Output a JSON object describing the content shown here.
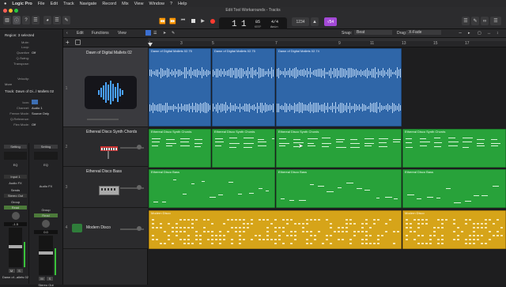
{
  "menubar": {
    "items": [
      "Logic Pro",
      "File",
      "Edit",
      "Track",
      "Navigate",
      "Record",
      "Mix",
      "View",
      "Window",
      "?",
      "Help"
    ]
  },
  "window": {
    "title": "Edit Tool Workarounds - Tracks"
  },
  "lcd": {
    "bar": "1",
    "beat": "1",
    "tempo": "85",
    "tempo_mode": "KEEP",
    "time_sig": "4/4",
    "key": "Amin"
  },
  "toolbar": {
    "count_label": "1234",
    "pill_badge": "√54"
  },
  "editbar": {
    "edit": "Edit",
    "functions": "Functions",
    "view": "View",
    "snap_label": "Snap:",
    "snap_value": "Beat",
    "drag_label": "Drag:",
    "drag_value": "X-Fade"
  },
  "ruler": {
    "ticks": [
      "1",
      "3",
      "5",
      "7",
      "9",
      "11",
      "13",
      "15",
      "17"
    ]
  },
  "inspector": {
    "region_header": "Region: 3 selected",
    "region_fields": [
      {
        "k": "Mute:",
        "v": ""
      },
      {
        "k": "Loop:",
        "v": ""
      },
      {
        "k": "Quantize",
        "v": "Off"
      },
      {
        "k": "Q-Swing:",
        "v": ""
      },
      {
        "k": "Transpose:",
        "v": ""
      },
      {
        "k": "Velocity:",
        "v": ""
      }
    ],
    "more_label": "More",
    "track_header": "Track:  Dawn of Di...l Mallets 02",
    "track_fields": [
      {
        "k": "Icon:",
        "v": ""
      },
      {
        "k": "Channel:",
        "v": "Audio 1"
      },
      {
        "k": "Freeze Mode:",
        "v": "Source Only"
      },
      {
        "k": "Q-Reference:",
        "v": ""
      },
      {
        "k": "Flex Mode:",
        "v": "Off"
      }
    ],
    "strip1": {
      "setting": "Setting",
      "eq": "EQ",
      "input": "Input 1",
      "audiofx": "Audio FX",
      "send": "Sends",
      "output": "Stereo Out",
      "group": "Group",
      "automation": "Read",
      "volume": "-1.5",
      "pan": "0.0",
      "m": "M",
      "s": "S",
      "name": "Dawn of...allets 02"
    },
    "strip2": {
      "setting": "Setting",
      "eq": "EQ",
      "audiofx": "Audio FX",
      "group": "Group",
      "automation": "Read",
      "volume": "0.0",
      "m": "M",
      "s": "S",
      "name": "Stereo Out"
    }
  },
  "tracks": [
    {
      "num": "1",
      "name": "Dawn of Digital Mallets 02",
      "icon": "waveform-icon"
    },
    {
      "num": "2",
      "name": "Ethereal Disco Synth Chords",
      "icon": "keyboard-synth-icon"
    },
    {
      "num": "3",
      "name": "Ethereal Disco Bass",
      "icon": "synth-module-icon"
    },
    {
      "num": "4",
      "name": "Modern Disco",
      "icon": "drummer-icon"
    }
  ],
  "regions": {
    "audio": [
      "Dawn of Digital Mallets 02.75",
      "Dawn of Digital Mallets 02.75",
      "Dawn of Digital Mallets 02.74"
    ],
    "chords": [
      "Ethereal Disco Synth Chords",
      "Ethereal Disco Synth Chords",
      "Ethereal Disco Synth Chords",
      "Ethereal Disco Synth Chords"
    ],
    "bass": [
      "Ethereal Disco Bass",
      "Ethereal Disco Bass",
      "Ethereal Disco Bass",
      "Ethereal Disco Bass"
    ],
    "drums": [
      "Modern Disco",
      "Modern Disco"
    ]
  },
  "colors": {
    "audio": "#2f66a8",
    "midi": "#28a23a",
    "drums": "#d6a419",
    "accent": "#a349d6"
  }
}
